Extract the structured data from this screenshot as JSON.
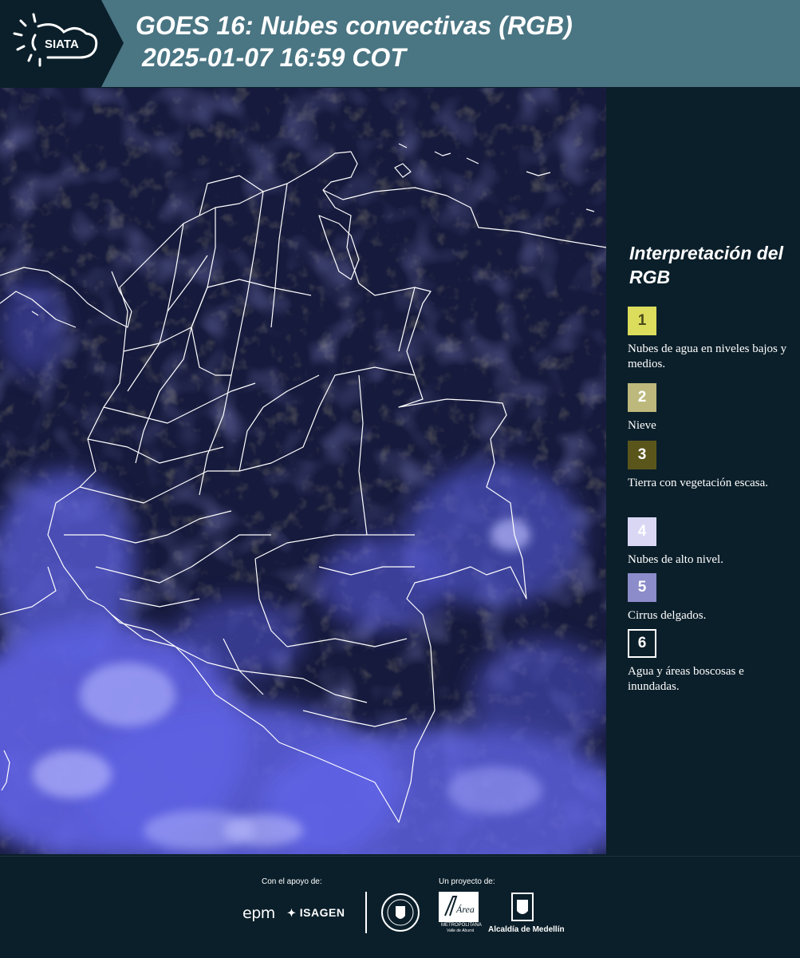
{
  "header": {
    "logo_text": "SIATA",
    "title_line1": "GOES 16: Nubes convectivas (RGB)",
    "title_line2": "2025-01-07 16:59 COT"
  },
  "colors": {
    "header_bg": "#4a7583",
    "logo_bg": "#0b1f2a",
    "page_bg": "#0b1f2a",
    "map_base": "#161a3c",
    "cloud_high": "#6f72f5",
    "borders": "#ffffff"
  },
  "legend": {
    "title": "Interpretación del RGB",
    "items": [
      {
        "number": "1",
        "label": "Nubes de agua en niveles bajos y medios.",
        "color": "#dcdd5c",
        "text_color": "#4a4a1a"
      },
      {
        "number": "2",
        "label": "Nieve",
        "color": "#bdb97c",
        "text_color": "#ffffff"
      },
      {
        "number": "3",
        "label": "Tierra con vegetación escasa.",
        "color": "#5a561b",
        "text_color": "#ffffff"
      },
      {
        "number": "4",
        "label": "Nubes de alto nivel.",
        "color": "#d9d7f4",
        "text_color": "#ffffff"
      },
      {
        "number": "5",
        "label": "Cirrus delgados.",
        "color": "#8c8cca",
        "text_color": "#ffffff"
      },
      {
        "number": "6",
        "label": "Agua y áreas boscosas e inundadas.",
        "color": "#0b1f2a",
        "text_color": "#ffffff"
      }
    ]
  },
  "footer": {
    "support_label": "Con el apoyo de:",
    "project_label": "Un proyecto de:",
    "epm": "epm",
    "isagen": "ISAGEN",
    "area_name": "Área",
    "area_line1": "METROPOLITANA",
    "area_line2": "Valle de Aburrá",
    "alcaldia": "Alcaldía de Medellín"
  }
}
